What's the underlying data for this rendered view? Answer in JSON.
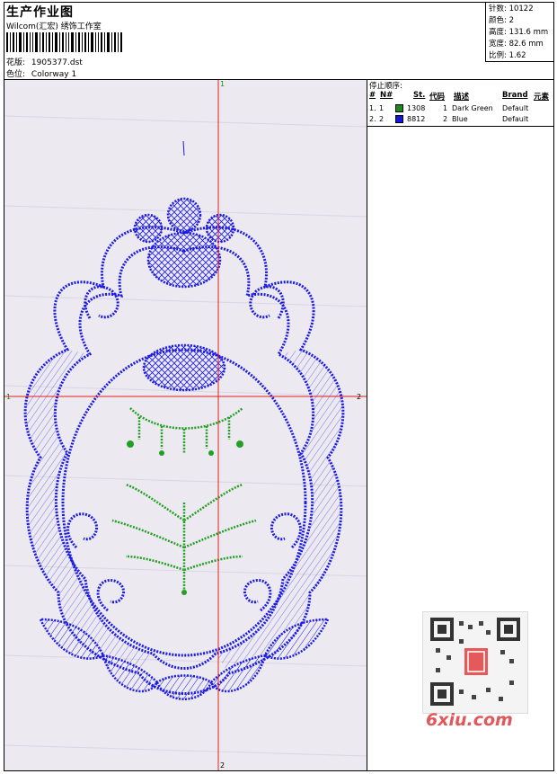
{
  "header": {
    "title": "生产作业图",
    "subtitle": "Wilcom(汇宏) 绣饰工作室",
    "design_label": "花版:",
    "design_value": "1905377.dst",
    "color_label": "色位:",
    "color_value": "Colorway 1"
  },
  "stats": [
    {
      "label": "针数:",
      "value": "10122"
    },
    {
      "label": "颜色:",
      "value": "2"
    },
    {
      "label": "高度:",
      "value": "131.6 mm"
    },
    {
      "label": "宽度:",
      "value": "82.6 mm"
    },
    {
      "label": "比例:",
      "value": "1.62"
    }
  ],
  "stop_sequence": {
    "title": "停止顺序:",
    "columns": [
      "#",
      "N#",
      "St.",
      "代码",
      "描述",
      "Brand",
      "元素"
    ],
    "rows": [
      {
        "index": "1.",
        "n": "1",
        "stitches": "1308",
        "code": "1",
        "description": "Dark Green",
        "brand": "Default",
        "color": "#1a8a1a"
      },
      {
        "index": "2.",
        "n": "2",
        "stitches": "8812",
        "code": "2",
        "description": "Blue",
        "brand": "Default",
        "color": "#1515e0"
      }
    ]
  },
  "crosshair_labels": {
    "top": "1",
    "bottom": "2",
    "left": "1",
    "right": "2"
  },
  "watermark": {
    "text": "6xiu.com"
  },
  "colors": {
    "design_blue": "#1a1ae6",
    "design_green": "#22a022",
    "crosshair": "#e02020"
  }
}
